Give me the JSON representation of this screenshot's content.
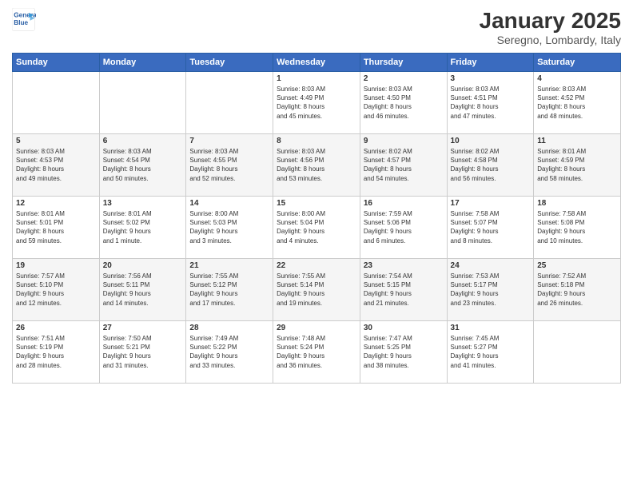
{
  "header": {
    "logo_line1": "General",
    "logo_line2": "Blue",
    "month": "January 2025",
    "location": "Seregno, Lombardy, Italy"
  },
  "weekdays": [
    "Sunday",
    "Monday",
    "Tuesday",
    "Wednesday",
    "Thursday",
    "Friday",
    "Saturday"
  ],
  "weeks": [
    [
      {
        "day": "",
        "info": ""
      },
      {
        "day": "",
        "info": ""
      },
      {
        "day": "",
        "info": ""
      },
      {
        "day": "1",
        "info": "Sunrise: 8:03 AM\nSunset: 4:49 PM\nDaylight: 8 hours\nand 45 minutes."
      },
      {
        "day": "2",
        "info": "Sunrise: 8:03 AM\nSunset: 4:50 PM\nDaylight: 8 hours\nand 46 minutes."
      },
      {
        "day": "3",
        "info": "Sunrise: 8:03 AM\nSunset: 4:51 PM\nDaylight: 8 hours\nand 47 minutes."
      },
      {
        "day": "4",
        "info": "Sunrise: 8:03 AM\nSunset: 4:52 PM\nDaylight: 8 hours\nand 48 minutes."
      }
    ],
    [
      {
        "day": "5",
        "info": "Sunrise: 8:03 AM\nSunset: 4:53 PM\nDaylight: 8 hours\nand 49 minutes."
      },
      {
        "day": "6",
        "info": "Sunrise: 8:03 AM\nSunset: 4:54 PM\nDaylight: 8 hours\nand 50 minutes."
      },
      {
        "day": "7",
        "info": "Sunrise: 8:03 AM\nSunset: 4:55 PM\nDaylight: 8 hours\nand 52 minutes."
      },
      {
        "day": "8",
        "info": "Sunrise: 8:03 AM\nSunset: 4:56 PM\nDaylight: 8 hours\nand 53 minutes."
      },
      {
        "day": "9",
        "info": "Sunrise: 8:02 AM\nSunset: 4:57 PM\nDaylight: 8 hours\nand 54 minutes."
      },
      {
        "day": "10",
        "info": "Sunrise: 8:02 AM\nSunset: 4:58 PM\nDaylight: 8 hours\nand 56 minutes."
      },
      {
        "day": "11",
        "info": "Sunrise: 8:01 AM\nSunset: 4:59 PM\nDaylight: 8 hours\nand 58 minutes."
      }
    ],
    [
      {
        "day": "12",
        "info": "Sunrise: 8:01 AM\nSunset: 5:01 PM\nDaylight: 8 hours\nand 59 minutes."
      },
      {
        "day": "13",
        "info": "Sunrise: 8:01 AM\nSunset: 5:02 PM\nDaylight: 9 hours\nand 1 minute."
      },
      {
        "day": "14",
        "info": "Sunrise: 8:00 AM\nSunset: 5:03 PM\nDaylight: 9 hours\nand 3 minutes."
      },
      {
        "day": "15",
        "info": "Sunrise: 8:00 AM\nSunset: 5:04 PM\nDaylight: 9 hours\nand 4 minutes."
      },
      {
        "day": "16",
        "info": "Sunrise: 7:59 AM\nSunset: 5:06 PM\nDaylight: 9 hours\nand 6 minutes."
      },
      {
        "day": "17",
        "info": "Sunrise: 7:58 AM\nSunset: 5:07 PM\nDaylight: 9 hours\nand 8 minutes."
      },
      {
        "day": "18",
        "info": "Sunrise: 7:58 AM\nSunset: 5:08 PM\nDaylight: 9 hours\nand 10 minutes."
      }
    ],
    [
      {
        "day": "19",
        "info": "Sunrise: 7:57 AM\nSunset: 5:10 PM\nDaylight: 9 hours\nand 12 minutes."
      },
      {
        "day": "20",
        "info": "Sunrise: 7:56 AM\nSunset: 5:11 PM\nDaylight: 9 hours\nand 14 minutes."
      },
      {
        "day": "21",
        "info": "Sunrise: 7:55 AM\nSunset: 5:12 PM\nDaylight: 9 hours\nand 17 minutes."
      },
      {
        "day": "22",
        "info": "Sunrise: 7:55 AM\nSunset: 5:14 PM\nDaylight: 9 hours\nand 19 minutes."
      },
      {
        "day": "23",
        "info": "Sunrise: 7:54 AM\nSunset: 5:15 PM\nDaylight: 9 hours\nand 21 minutes."
      },
      {
        "day": "24",
        "info": "Sunrise: 7:53 AM\nSunset: 5:17 PM\nDaylight: 9 hours\nand 23 minutes."
      },
      {
        "day": "25",
        "info": "Sunrise: 7:52 AM\nSunset: 5:18 PM\nDaylight: 9 hours\nand 26 minutes."
      }
    ],
    [
      {
        "day": "26",
        "info": "Sunrise: 7:51 AM\nSunset: 5:19 PM\nDaylight: 9 hours\nand 28 minutes."
      },
      {
        "day": "27",
        "info": "Sunrise: 7:50 AM\nSunset: 5:21 PM\nDaylight: 9 hours\nand 31 minutes."
      },
      {
        "day": "28",
        "info": "Sunrise: 7:49 AM\nSunset: 5:22 PM\nDaylight: 9 hours\nand 33 minutes."
      },
      {
        "day": "29",
        "info": "Sunrise: 7:48 AM\nSunset: 5:24 PM\nDaylight: 9 hours\nand 36 minutes."
      },
      {
        "day": "30",
        "info": "Sunrise: 7:47 AM\nSunset: 5:25 PM\nDaylight: 9 hours\nand 38 minutes."
      },
      {
        "day": "31",
        "info": "Sunrise: 7:45 AM\nSunset: 5:27 PM\nDaylight: 9 hours\nand 41 minutes."
      },
      {
        "day": "",
        "info": ""
      }
    ]
  ]
}
